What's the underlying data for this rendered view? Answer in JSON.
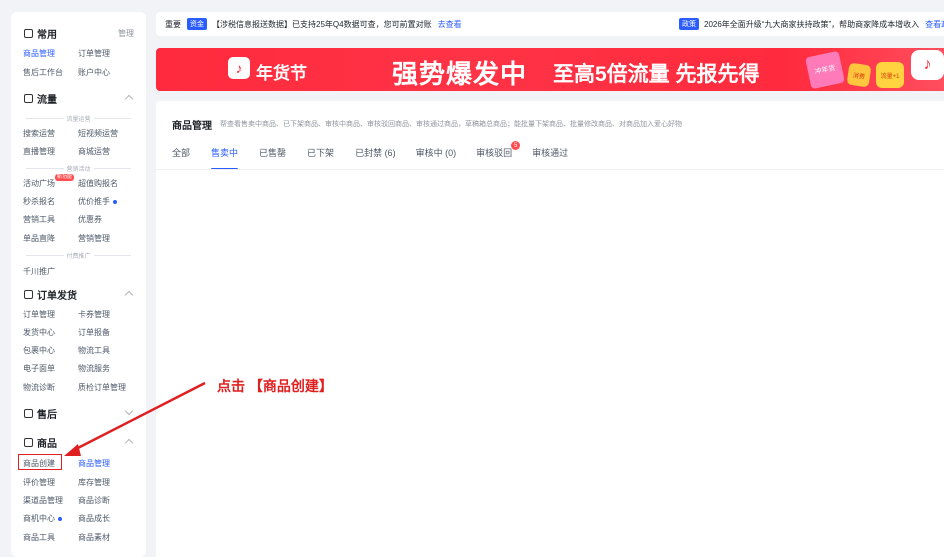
{
  "sidebar": {
    "common": {
      "title": "常用",
      "manage": "管理"
    },
    "common_items": [
      "商品管理",
      "订单管理",
      "售后工作台",
      "账户中心"
    ],
    "traffic": {
      "title": "流量"
    },
    "traffic_sub1": "流量运营",
    "traffic_items1": [
      "搜索运营",
      "短视频运营",
      "直播管理",
      "商城运营"
    ],
    "traffic_sub2": "营销活动",
    "traffic_items2": [
      "活动广场",
      "超值购报名",
      "秒杀报名",
      "优价推手",
      "营销工具",
      "优惠券",
      "单品直降",
      "营销管理"
    ],
    "traffic_new_tag": "新功能",
    "traffic_sub3": "付费推广",
    "traffic_items3": [
      "千川推广"
    ],
    "order": {
      "title": "订单发货"
    },
    "order_items": [
      "订单管理",
      "卡券管理",
      "发货中心",
      "订单报备",
      "包裹中心",
      "物流工具",
      "电子面单",
      "物流服务",
      "物流诊断",
      "质检订单管理"
    ],
    "aftersale": {
      "title": "售后"
    },
    "goods": {
      "title": "商品"
    },
    "goods_items": [
      "商品创建",
      "商品管理",
      "评价管理",
      "库存管理",
      "渠道品管理",
      "商品诊断",
      "商机中心",
      "商品成长",
      "商品工具",
      "商品素材"
    ]
  },
  "notice": {
    "type": "重要",
    "badge": "资金",
    "text": "【涉税信息报送数据】已支持25年Q4数据可查，您可前置对账",
    "link": "去查看",
    "right_badge": "政策",
    "right_text": "2026年全面升级“九大商家扶持政策”，帮助商家降成本增收入",
    "right_link": "查看政"
  },
  "banner": {
    "festival": "年货节",
    "slogan": "强势爆发中",
    "subslogan": "至高5倍流量 先报先得",
    "deco1": "冲年货",
    "deco2": "消费",
    "deco3": "流量+1"
  },
  "main": {
    "title": "商品管理",
    "desc": "帮查看售卖中商品、已下架商品、审核中商品、审核驳回商品、审核通过商品，草稿箱总商品；能批量下架商品、批量修改商品、对商品加入爱心好物",
    "tabs": [
      "全部",
      "售卖中",
      "已售罄",
      "已下架",
      "已封禁 (6)",
      "审核中 (0)",
      "审核驳回",
      "审核通过"
    ],
    "rejected_badge": "5"
  },
  "annotation": {
    "text": "点击 【商品创建】"
  },
  "colors": {
    "accent": "#2a5cff",
    "annotation": "#e02020",
    "banner": "#ff2a3d"
  }
}
